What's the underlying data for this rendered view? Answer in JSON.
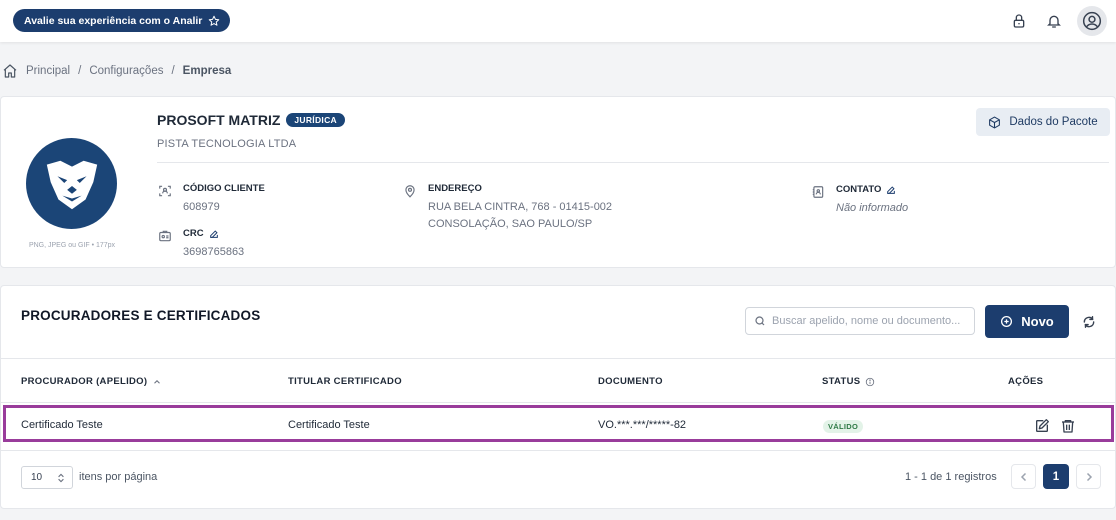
{
  "topbar": {
    "rate_button_label": "Avalie sua experiência com o Analir",
    "icons": [
      "lock-icon",
      "bell-icon",
      "user-circle-icon"
    ]
  },
  "breadcrumb": {
    "items": [
      "Principal",
      "Configurações",
      "Empresa"
    ],
    "separator": "/"
  },
  "company": {
    "name": "PROSOFT MATRIZ",
    "type_badge": "JURÍDICA",
    "legal_name": "PISTA TECNOLOGIA LTDA",
    "logo_hint": "PNG, JPEG ou GIF • 177px",
    "package_button_label": "Dados do Pacote",
    "fields": {
      "client_code": {
        "label": "CÓDIGO CLIENTE",
        "value": "608979"
      },
      "crc": {
        "label": "CRC",
        "value": "3698765863"
      },
      "address": {
        "label": "ENDEREÇO",
        "line1": "RUA BELA CINTRA, 768 - 01415-002",
        "line2": "CONSOLAÇÃO, SAO PAULO/SP"
      },
      "contact": {
        "label": "CONTATO",
        "value": "Não informado"
      }
    }
  },
  "procuradores": {
    "title": "PROCURADORES E CERTIFICADOS",
    "search_placeholder": "Buscar apelido, nome ou documento...",
    "new_button_label": "Novo",
    "columns": [
      "PROCURADOR (APELIDO)",
      "TITULAR CERTIFICADO",
      "DOCUMENTO",
      "STATUS",
      "AÇÕES"
    ],
    "rows": [
      {
        "procurador": "Certificado Teste",
        "titular": "Certificado Teste",
        "documento": "VO.***.***/*****-82",
        "status": "VÁLIDO"
      }
    ],
    "pagination": {
      "per_page": "10",
      "per_page_label": "itens por página",
      "range": "1 - 1 de 1 registros",
      "current_page": "1"
    }
  },
  "colors": {
    "primary": "#1c3d6e",
    "highlight_border": "#993c9b",
    "status_valid_bg": "#e3f3e8",
    "status_valid_text": "#2f7a46"
  }
}
